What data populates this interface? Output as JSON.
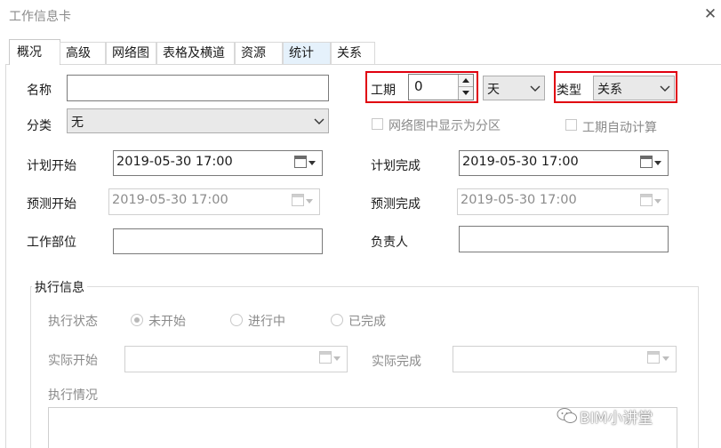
{
  "window": {
    "title": "工作信息卡",
    "close_glyph": "✕"
  },
  "tabs": [
    "概况",
    "高级",
    "网络图",
    "表格及横道",
    "资源",
    "统计",
    "关系"
  ],
  "form": {
    "name_label": "名称",
    "name_value": "",
    "category_label": "分类",
    "category_value": "无",
    "duration_label": "工期",
    "duration_value": "0",
    "duration_unit": "天",
    "type_label": "类型",
    "type_value": "关系",
    "show_as_partition_label": "网络图中显示为分区",
    "auto_calc_duration_label": "工期自动计算",
    "plan_start_label": "计划开始",
    "plan_start_value": "2019-05-30 17:00",
    "plan_finish_label": "计划完成",
    "plan_finish_value": "2019-05-30 17:00",
    "forecast_start_label": "预测开始",
    "forecast_start_value": "2019-05-30 17:00",
    "forecast_finish_label": "预测完成",
    "forecast_finish_value": "2019-05-30 17:00",
    "department_label": "工作部位",
    "department_value": "",
    "owner_label": "负责人",
    "owner_value": ""
  },
  "execution": {
    "title": "执行信息",
    "status_label": "执行状态",
    "status_options": [
      "未开始",
      "进行中",
      "已完成"
    ],
    "status_selected": "未开始",
    "actual_start_label": "实际开始",
    "actual_finish_label": "实际完成",
    "notes_label": "执行情况"
  },
  "watermark": {
    "text": "BIM小讲堂",
    "icon": "wechat-icon"
  },
  "colors": {
    "highlight": "#e0000f",
    "stat_tab": "#e5f1fb",
    "disabled_text": "#8a8a8a"
  }
}
